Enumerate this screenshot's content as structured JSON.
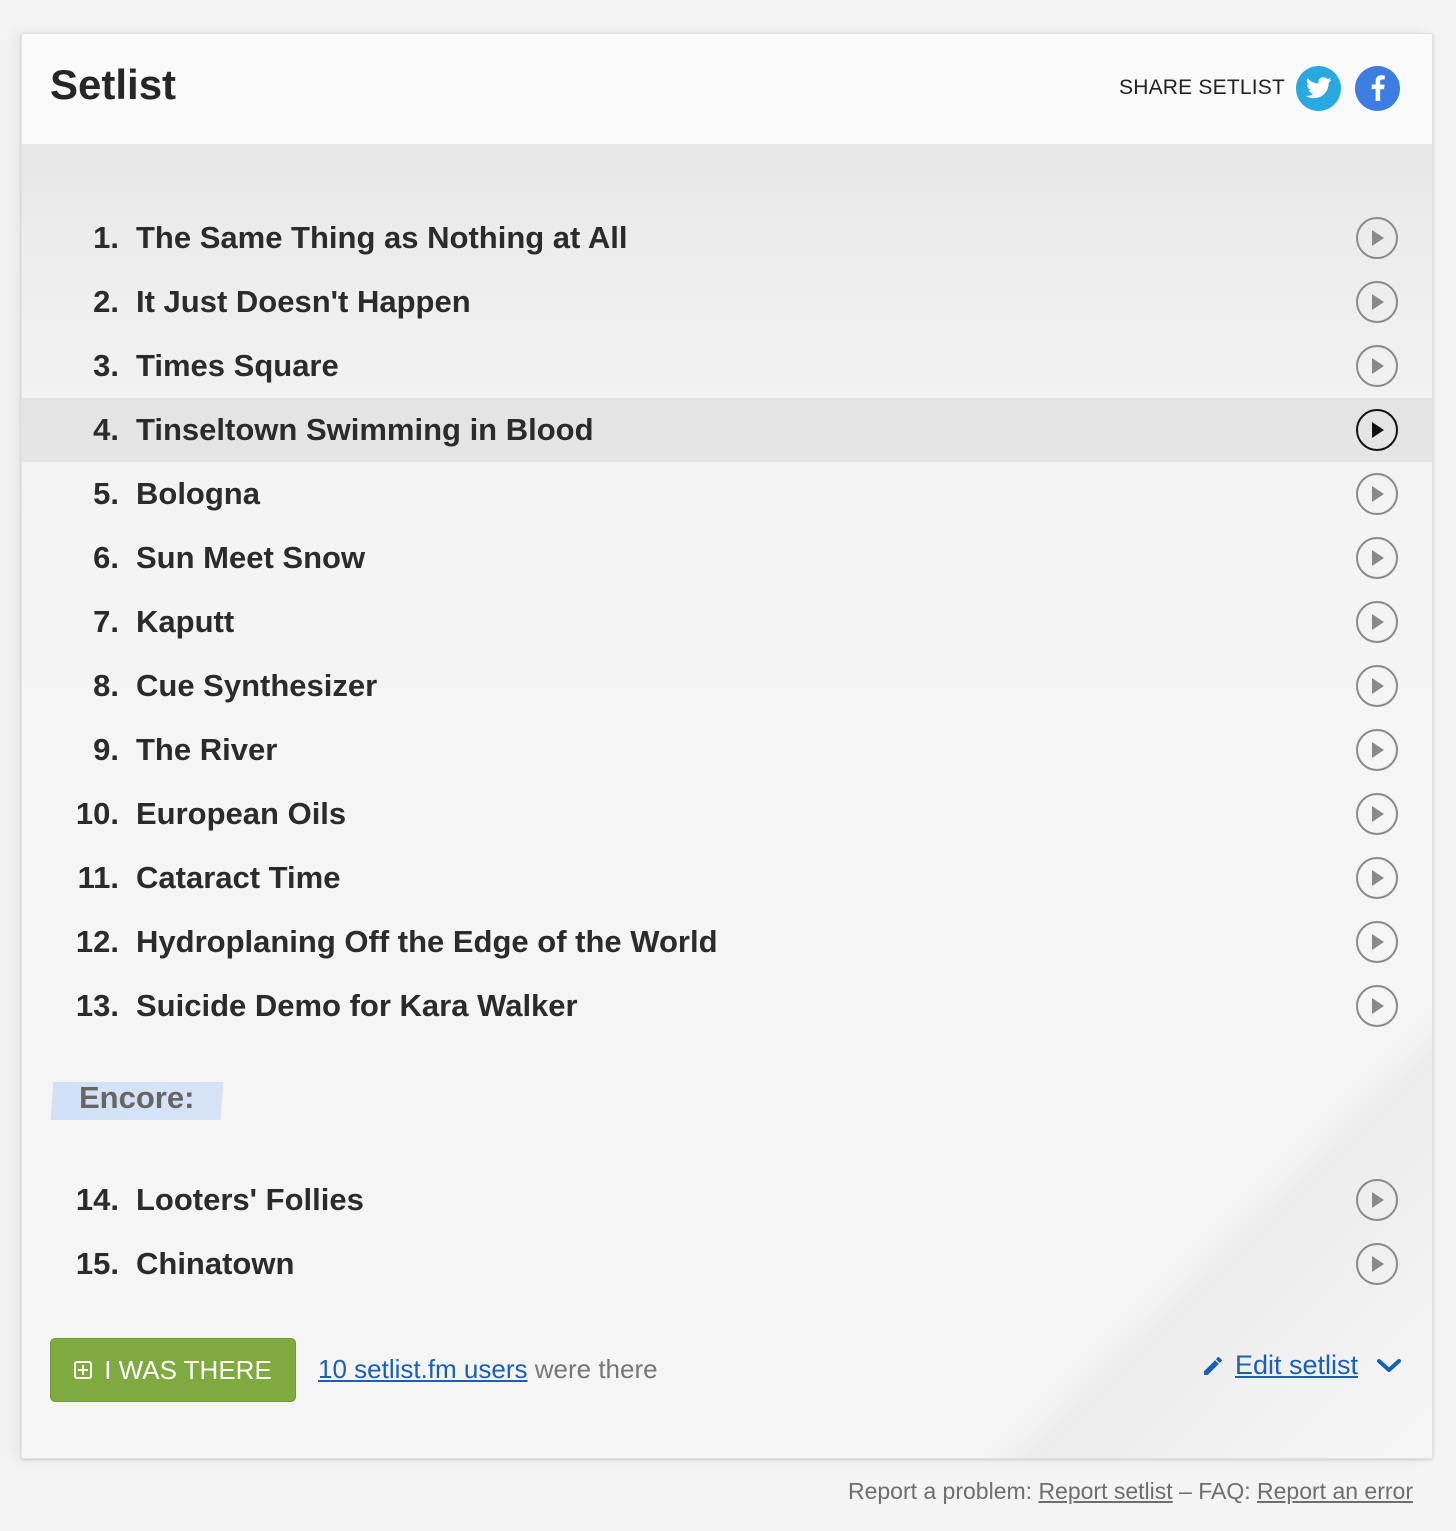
{
  "header": {
    "title": "Setlist",
    "share_label": "SHARE SETLIST",
    "share_icons": [
      "twitter-icon",
      "facebook-icon"
    ]
  },
  "songs": [
    {
      "num": "1.",
      "title": "The Same Thing as Nothing at All"
    },
    {
      "num": "2.",
      "title": "It Just Doesn't Happen"
    },
    {
      "num": "3.",
      "title": "Times Square"
    },
    {
      "num": "4.",
      "title": "Tinseltown Swimming in Blood"
    },
    {
      "num": "5.",
      "title": "Bologna"
    },
    {
      "num": "6.",
      "title": "Sun Meet Snow"
    },
    {
      "num": "7.",
      "title": "Kaputt"
    },
    {
      "num": "8.",
      "title": "Cue Synthesizer"
    },
    {
      "num": "9.",
      "title": "The River"
    },
    {
      "num": "10.",
      "title": "European Oils"
    },
    {
      "num": "11.",
      "title": "Cataract Time"
    },
    {
      "num": "12.",
      "title": "Hydroplaning Off the Edge of the World"
    },
    {
      "num": "13.",
      "title": "Suicide Demo for Kara Walker"
    }
  ],
  "encore": {
    "label": "Encore:",
    "songs": [
      {
        "num": "14.",
        "title": "Looters' Follies"
      },
      {
        "num": "15.",
        "title": "Chinatown"
      }
    ]
  },
  "highlighted_song": "4.",
  "footer": {
    "was_there_label": "I WAS THERE",
    "users_link": "10 setlist.fm users",
    "users_suffix": " were there",
    "edit_label": "Edit setlist"
  },
  "report": {
    "prefix": "Report a problem: ",
    "report_link": "Report setlist",
    "faq_prefix": " – FAQ: ",
    "faq_link": "Report an error"
  },
  "colors": {
    "button_green": "#7faa3f",
    "link_blue": "#1a5fb4",
    "twitter": "#2aa9e0",
    "facebook": "#3b7de0"
  }
}
